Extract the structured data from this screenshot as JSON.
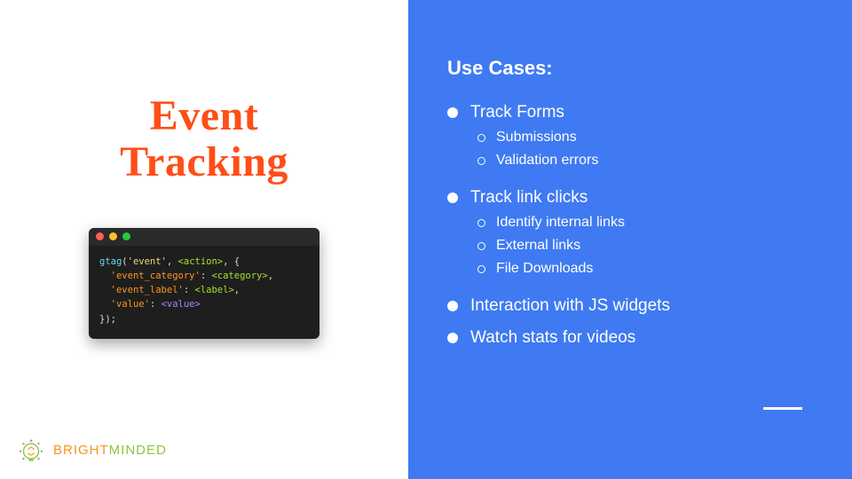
{
  "title_line1": "Event",
  "title_line2": "Tracking",
  "code": {
    "fn": "gtag",
    "event": "'event'",
    "action": "<action>",
    "k_category": "'event_category'",
    "v_category": "<category>",
    "k_label": "'event_label'",
    "v_label": "<label>",
    "k_value": "'value'",
    "v_value": "<value>"
  },
  "logo": {
    "part1": "BRIGHT",
    "part2": "MINDED"
  },
  "right": {
    "heading": "Use Cases:",
    "items": [
      {
        "label": "Track Forms",
        "sub": [
          "Submissions",
          "Validation errors"
        ]
      },
      {
        "label": "Track link clicks",
        "sub": [
          "Identify internal links",
          "External links",
          "File Downloads"
        ]
      },
      {
        "label": "Interaction with JS widgets",
        "sub": []
      },
      {
        "label": "Watch stats for videos",
        "sub": []
      }
    ]
  }
}
